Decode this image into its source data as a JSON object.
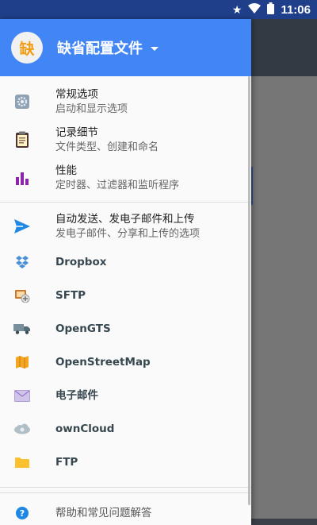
{
  "status_bar": {
    "time": "11:06"
  },
  "drawer": {
    "avatar_text": "缺",
    "profile_name": "缺省配置文件",
    "settings": [
      {
        "title": "常规选项",
        "subtitle": "启动和显示选项",
        "icon": "gear-icon"
      },
      {
        "title": "记录细节",
        "subtitle": "文件类型、创建和命名",
        "icon": "clipboard-icon"
      },
      {
        "title": "性能",
        "subtitle": "定时器、过滤器和监听程序",
        "icon": "bar-chart-icon"
      }
    ],
    "autosend": {
      "title": "自动发送、发电子邮件和上传",
      "subtitle": "发电子邮件、分享和上传的选项"
    },
    "targets": [
      {
        "label": "Dropbox",
        "icon": "dropbox-icon"
      },
      {
        "label": "SFTP",
        "icon": "server-icon"
      },
      {
        "label": "OpenGTS",
        "icon": "truck-icon"
      },
      {
        "label": "OpenStreetMap",
        "icon": "map-icon"
      },
      {
        "label": "电子邮件",
        "icon": "envelope-icon"
      },
      {
        "label": "ownCloud",
        "icon": "cloud-icon"
      },
      {
        "label": "FTP",
        "icon": "folder-icon"
      }
    ],
    "help": {
      "label": "帮助和常见问题解答"
    }
  },
  "colors": {
    "header": "#4285f4",
    "status_bar": "#1f3f8a",
    "accent_send": "#1e88e5"
  }
}
